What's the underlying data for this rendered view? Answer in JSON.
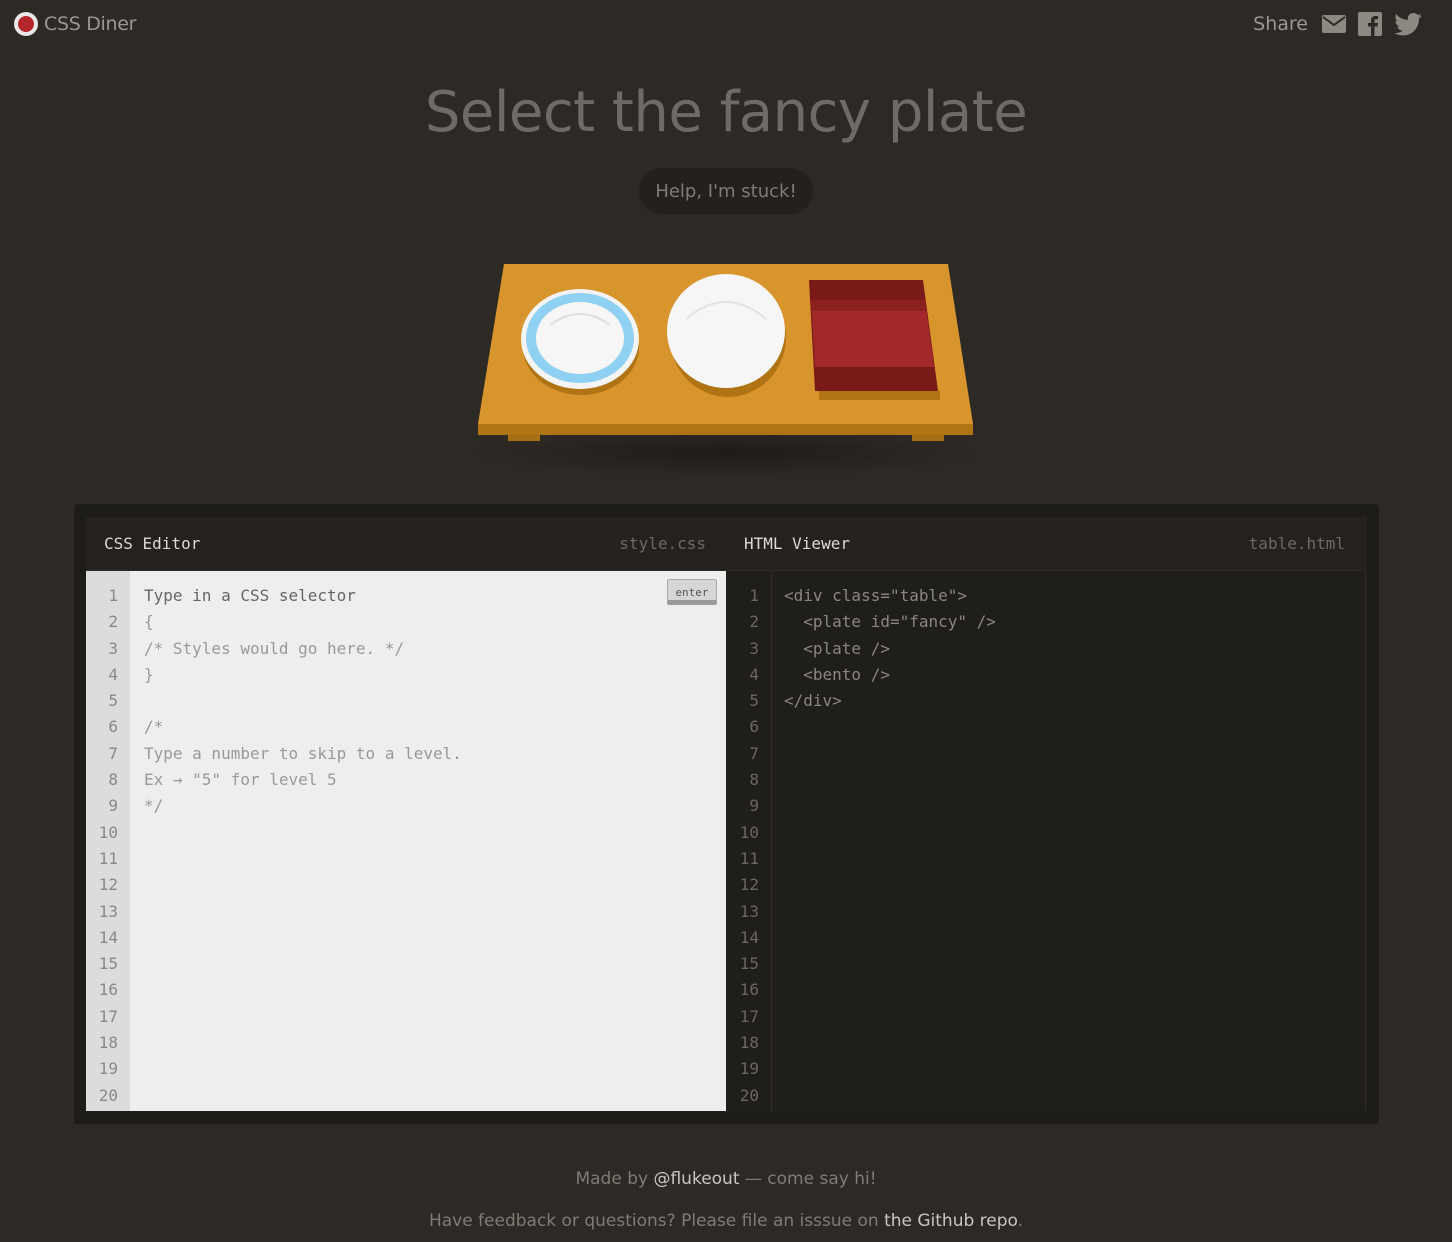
{
  "app": {
    "name": "CSS Diner"
  },
  "share": {
    "label": "Share",
    "icons": [
      "email-icon",
      "facebook-icon",
      "twitter-icon"
    ]
  },
  "level": {
    "instruction": "Select the fancy plate",
    "help_button": "Help, I'm stuck!"
  },
  "table": {
    "items": [
      "plate-fancy",
      "plate",
      "bento"
    ]
  },
  "css_editor": {
    "title": "CSS Editor",
    "filename": "style.css",
    "enter_label": "enter",
    "input_placeholder": "Type in a CSS selector",
    "lines": [
      "{",
      "/* Styles would go here. */",
      "}",
      "",
      "/*",
      "Type a number to skip to a level.",
      "Ex → \"5\" for level 5",
      "*/"
    ],
    "line_numbers": [
      "1",
      "2",
      "3",
      "4",
      "5",
      "6",
      "7",
      "8",
      "9",
      "10",
      "11",
      "12",
      "13",
      "14",
      "15",
      "16",
      "17",
      "18",
      "19",
      "20"
    ]
  },
  "html_viewer": {
    "title": "HTML Viewer",
    "filename": "table.html",
    "lines": [
      "<div class=\"table\">",
      "  <plate id=\"fancy\" />",
      "  <plate />",
      "  <bento />",
      "</div>"
    ],
    "line_numbers": [
      "1",
      "2",
      "3",
      "4",
      "5",
      "6",
      "7",
      "8",
      "9",
      "10",
      "11",
      "12",
      "13",
      "14",
      "15",
      "16",
      "17",
      "18",
      "19",
      "20"
    ]
  },
  "footer": {
    "made_by_prefix": "Made by ",
    "author_link": "@flukeout",
    "made_by_suffix": " — come say hi!",
    "feedback_prefix": "Have feedback or questions? Please file an isssue on ",
    "repo_link": "the Github repo",
    "feedback_suffix": "."
  },
  "colors": {
    "background": "#2d2a26",
    "table": "#d9952d",
    "bento": "#a3282a",
    "fancy_rim": "#8fd1f2"
  }
}
